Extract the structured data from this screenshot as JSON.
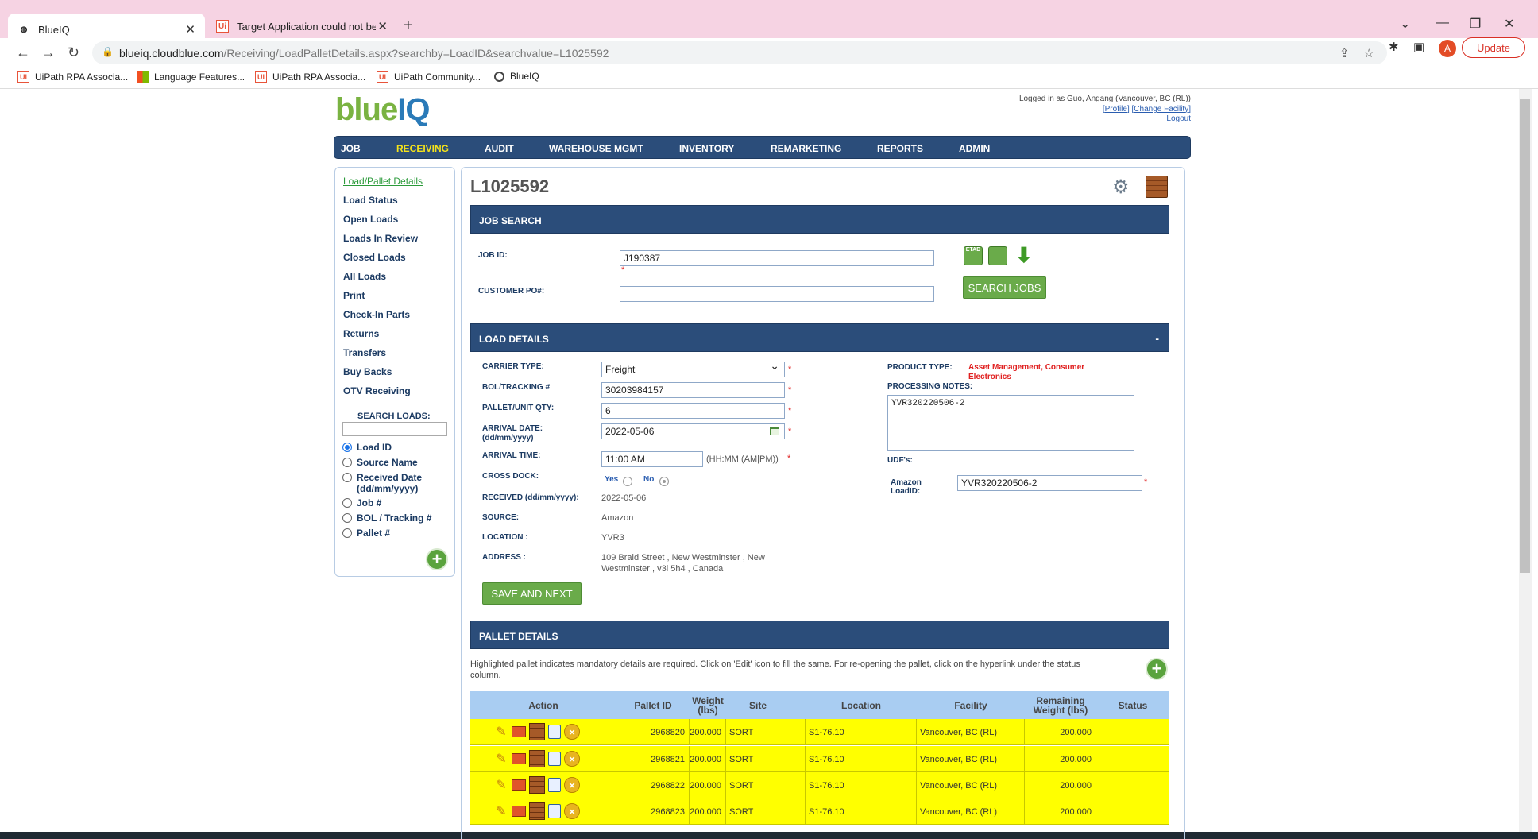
{
  "browser": {
    "tabs": [
      {
        "title": "BlueIQ",
        "icon": "globe-icon",
        "active": true
      },
      {
        "title": "Target Application could not be i",
        "icon": "uipath-icon",
        "active": false
      }
    ],
    "url_host": "blueiq.cloudblue.com",
    "url_path": "/Receiving/LoadPalletDetails.aspx?searchby=LoadID&searchvalue=L1025592",
    "avatar_letter": "A",
    "update_label": "Update",
    "bookmarks": [
      {
        "label": "UiPath RPA Associa...",
        "icon": "uipath-icon"
      },
      {
        "label": "Language Features...",
        "icon": "microsoft-icon"
      },
      {
        "label": "UiPath RPA Associa...",
        "icon": "uipath-icon"
      },
      {
        "label": "UiPath Community...",
        "icon": "uipath-icon"
      },
      {
        "label": "BlueIQ",
        "icon": "globe-icon"
      }
    ]
  },
  "app": {
    "logo_part1": "blue",
    "logo_part2": "IQ",
    "login_text": "Logged in as Guo, Angang (Vancouver, BC (RL))",
    "profile_link": "[Profile]",
    "change_facility_link": "[Change Facility]",
    "logout_link": "Logout",
    "nav": [
      "JOB",
      "RECEIVING",
      "AUDIT",
      "WAREHOUSE MGMT",
      "INVENTORY",
      "REMARKETING",
      "REPORTS",
      "ADMIN"
    ],
    "nav_active": "RECEIVING",
    "accent": "#2b4d7a"
  },
  "sidebar": {
    "links": [
      "Load/Pallet Details",
      "Load Status",
      "Open Loads",
      "Loads In Review",
      "Closed Loads",
      "All Loads",
      "Print",
      "Check-In Parts",
      "Returns",
      "Transfers",
      "Buy Backs",
      "OTV Receiving"
    ],
    "search_label": "SEARCH LOADS:",
    "search_value": "",
    "radios": [
      "Load ID",
      "Source Name",
      "Received Date (dd/mm/yyyy)",
      "Job #",
      "BOL / Tracking #",
      "Pallet #"
    ],
    "radio_selected": "Load ID"
  },
  "main": {
    "load_id": "L1025592",
    "job_search": {
      "header": "JOB SEARCH",
      "job_id_label": "JOB ID:",
      "job_id_value": "J190387",
      "customer_po_label": "CUSTOMER PO#:",
      "customer_po_value": "",
      "etad_label": "ETAD",
      "search_button": "SEARCH JOBS"
    },
    "load_details": {
      "header": "LOAD DETAILS",
      "collapse": "-",
      "carrier_type_label": "CARRIER TYPE:",
      "carrier_type_value": "Freight",
      "bol_label": "BOL/TRACKING #",
      "bol_value": "30203984157",
      "pallet_qty_label": "PALLET/UNIT QTY:",
      "pallet_qty_value": "6",
      "arrival_date_label": "ARRIVAL DATE:",
      "arrival_date_format": "(dd/mm/yyyy)",
      "arrival_date_value": "2022-05-06",
      "arrival_time_label": "ARRIVAL TIME:",
      "arrival_time_value": "11:00 AM",
      "arrival_time_hint": "(HH:MM (AM|PM))",
      "cross_dock_label": "CROSS DOCK:",
      "cross_dock_yes": "Yes",
      "cross_dock_no": "No",
      "cross_dock_selected": "No",
      "received_label": "RECEIVED (dd/mm/yyyy):",
      "received_value": "2022-05-06",
      "source_label": "SOURCE:",
      "source_value": "Amazon",
      "location_label": "LOCATION :",
      "location_value": "YVR3",
      "address_label": "ADDRESS :",
      "address_line1": "109 Braid Street , New Westminster , New",
      "address_line2": "Westminster , v3l 5h4 , Canada",
      "product_type_label": "PRODUCT TYPE:",
      "product_type_value1": "Asset Management, Consumer",
      "product_type_value2": "Electronics",
      "processing_notes_label": "PROCESSING NOTES:",
      "processing_notes_value": "YVR320220506-2",
      "udf_label": "UDF's:",
      "amazon_label1": "Amazon",
      "amazon_label2": "LoadID:",
      "amazon_value": "YVR320220506-2",
      "save_button": "SAVE AND NEXT"
    },
    "pallet_details": {
      "header": "PALLET DETAILS",
      "note_line1": "Highlighted pallet indicates mandatory details are required. Click on 'Edit' icon to fill the same. For re-opening the pallet, click on the hyperlink under the status",
      "note_line2": "column.",
      "columns": [
        "Action",
        "Pallet ID",
        "Weight (lbs)",
        "Site",
        "Location",
        "Facility",
        "Remaining Weight (lbs)",
        "Status"
      ],
      "rows": [
        {
          "pallet_id": "2968820",
          "weight": "200.000",
          "site": "SORT",
          "location": "S1-76.10",
          "facility": "Vancouver, BC (RL)",
          "remaining": "200.000",
          "status": ""
        },
        {
          "pallet_id": "2968821",
          "weight": "200.000",
          "site": "SORT",
          "location": "S1-76.10",
          "facility": "Vancouver, BC (RL)",
          "remaining": "200.000",
          "status": ""
        },
        {
          "pallet_id": "2968822",
          "weight": "200.000",
          "site": "SORT",
          "location": "S1-76.10",
          "facility": "Vancouver, BC (RL)",
          "remaining": "200.000",
          "status": ""
        },
        {
          "pallet_id": "2968823",
          "weight": "200.000",
          "site": "SORT",
          "location": "S1-76.10",
          "facility": "Vancouver, BC (RL)",
          "remaining": "200.000",
          "status": ""
        }
      ],
      "highlight_color": "#ffff00"
    }
  }
}
